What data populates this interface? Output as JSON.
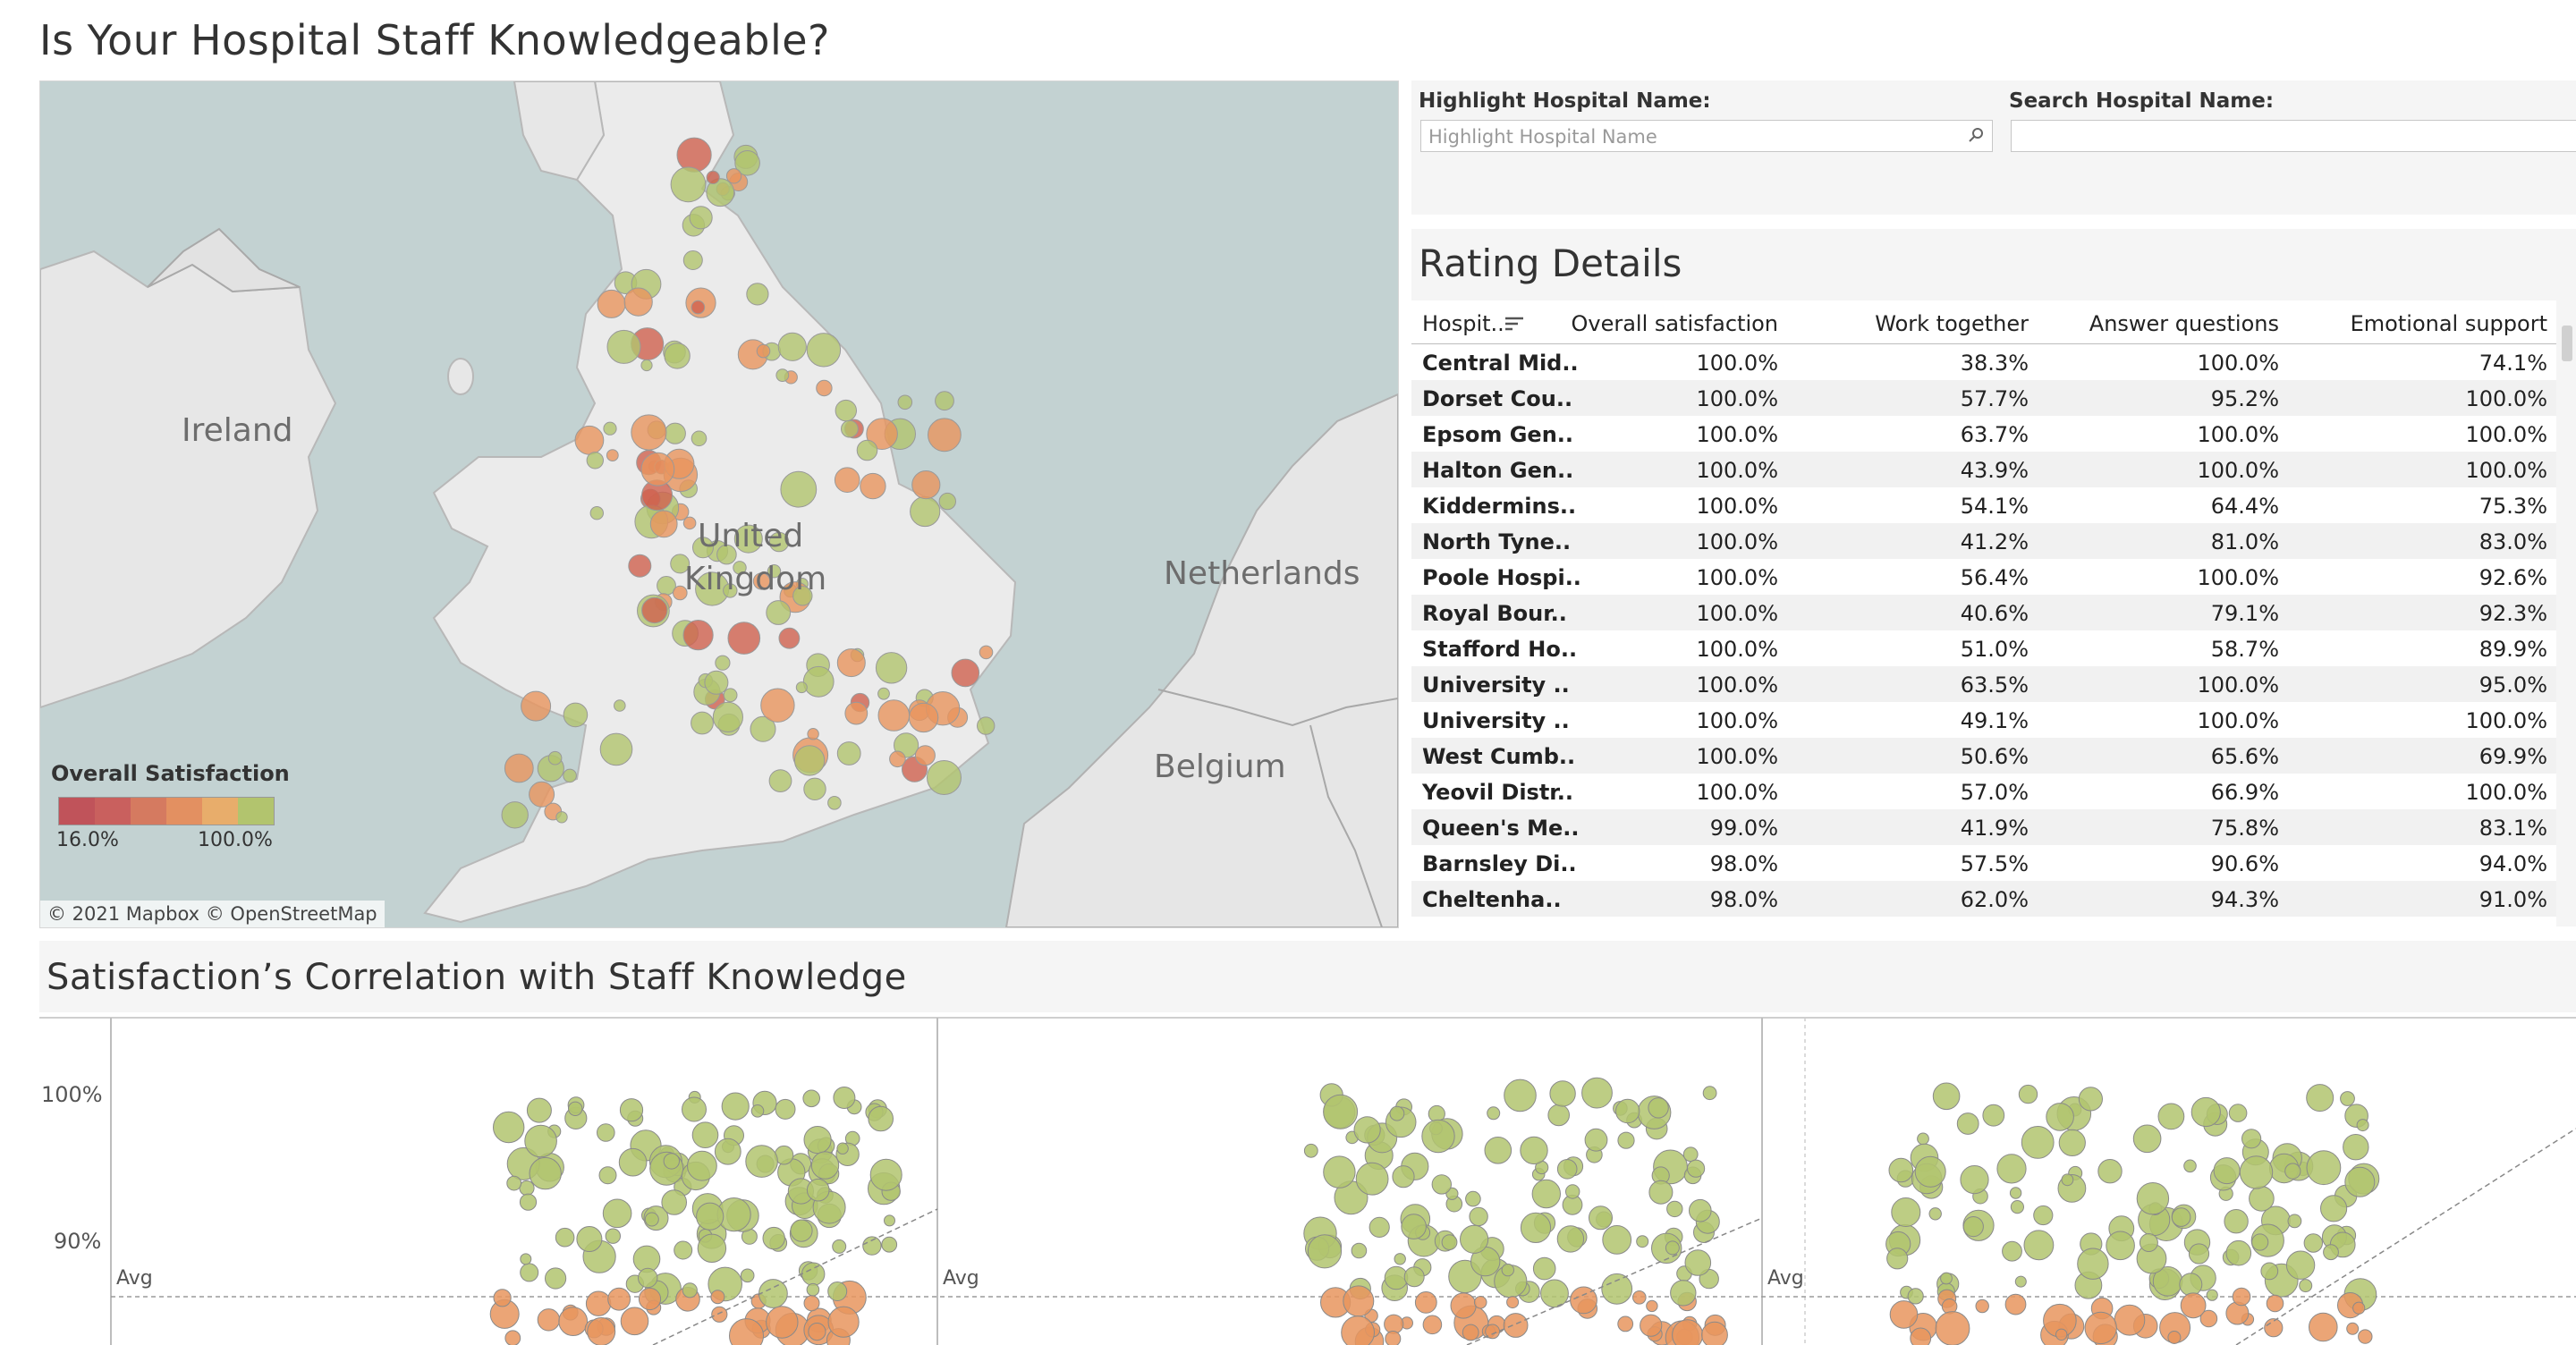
{
  "title": "Is Your Hospital Staff Knowledgeable?",
  "map": {
    "labels": {
      "ireland": "Ireland",
      "united": "United",
      "kingdom": "Kingdom",
      "netherlands": "Netherlands",
      "belgium": "Belgium"
    },
    "legend": {
      "title": "Overall Satisfaction",
      "min": "16.0%",
      "max": "100.0%",
      "colors": [
        "#c0535a",
        "#c9605e",
        "#d57a60",
        "#e39061",
        "#e8ad6b",
        "#b2c46e"
      ]
    },
    "attribution": "© 2021 Mapbox  © OpenStreetMap",
    "colors": {
      "sea": "#c3d2d2",
      "land": "#e8e8e8",
      "green": "#b2c46e",
      "orange": "#e8955e",
      "red": "#d0614f"
    }
  },
  "filters": {
    "highlight_label": "Highlight Hospital Name:",
    "highlight_placeholder": "Highlight Hospital Name",
    "search_label": "Search Hospital Name:",
    "search_value": ""
  },
  "details": {
    "title": "Rating Details",
    "columns": [
      "Hospit..",
      "Overall satisfaction",
      "Work together",
      "Answer questions",
      "Emotional support"
    ],
    "rows": [
      [
        "Central Mid..",
        "100.0%",
        "38.3%",
        "100.0%",
        "74.1%"
      ],
      [
        "Dorset Cou..",
        "100.0%",
        "57.7%",
        "95.2%",
        "100.0%"
      ],
      [
        "Epsom Gen..",
        "100.0%",
        "63.7%",
        "100.0%",
        "100.0%"
      ],
      [
        "Halton Gen..",
        "100.0%",
        "43.9%",
        "100.0%",
        "100.0%"
      ],
      [
        "Kiddermins..",
        "100.0%",
        "54.1%",
        "64.4%",
        "75.3%"
      ],
      [
        "North Tyne..",
        "100.0%",
        "41.2%",
        "81.0%",
        "83.0%"
      ],
      [
        "Poole Hospi..",
        "100.0%",
        "56.4%",
        "100.0%",
        "92.6%"
      ],
      [
        "Royal Bour..",
        "100.0%",
        "40.6%",
        "79.1%",
        "92.3%"
      ],
      [
        "Stafford Ho..",
        "100.0%",
        "51.0%",
        "58.7%",
        "89.9%"
      ],
      [
        "University ..",
        "100.0%",
        "63.5%",
        "100.0%",
        "95.0%"
      ],
      [
        "University ..",
        "100.0%",
        "49.1%",
        "100.0%",
        "100.0%"
      ],
      [
        "West Cumb..",
        "100.0%",
        "50.6%",
        "65.6%",
        "69.9%"
      ],
      [
        "Yeovil Distr..",
        "100.0%",
        "57.0%",
        "66.9%",
        "100.0%"
      ],
      [
        "Queen's Me..",
        "99.0%",
        "41.9%",
        "75.8%",
        "83.1%"
      ],
      [
        "Barnsley Di..",
        "98.0%",
        "57.5%",
        "90.6%",
        "94.0%"
      ],
      [
        "Cheltenha..",
        "98.0%",
        "62.0%",
        "94.3%",
        "91.0%"
      ]
    ]
  },
  "correlation": {
    "title": "Satisfaction’s Correlation with Staff Knowledge",
    "y_ticks": [
      "100%",
      "90%"
    ],
    "avg_label": "Avg"
  }
}
